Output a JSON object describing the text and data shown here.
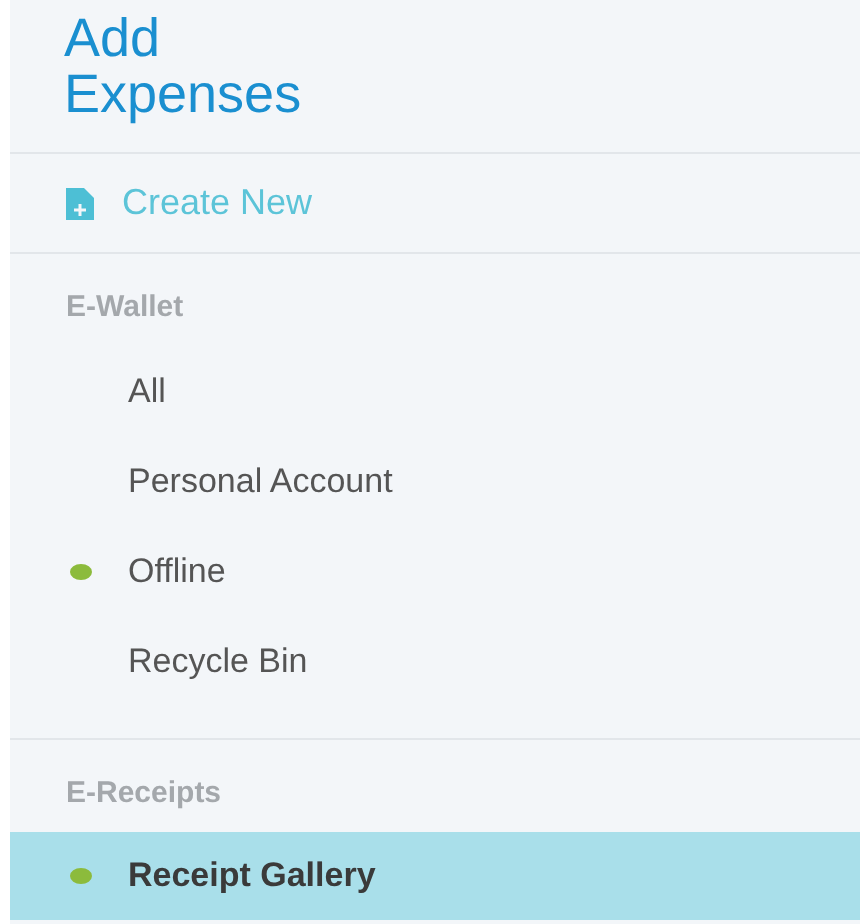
{
  "title": [
    "Add",
    "Expenses"
  ],
  "create_button": {
    "label": "Create New"
  },
  "sections": [
    {
      "heading": "E-Wallet",
      "items": [
        {
          "label": "All",
          "dot": false,
          "selected": false
        },
        {
          "label": "Personal Account",
          "dot": false,
          "selected": false
        },
        {
          "label": "Offline",
          "dot": true,
          "selected": false
        },
        {
          "label": "Recycle Bin",
          "dot": false,
          "selected": false
        }
      ]
    },
    {
      "heading": "E-Receipts",
      "items": [
        {
          "label": "Receipt Gallery",
          "dot": true,
          "selected": true
        }
      ]
    }
  ]
}
